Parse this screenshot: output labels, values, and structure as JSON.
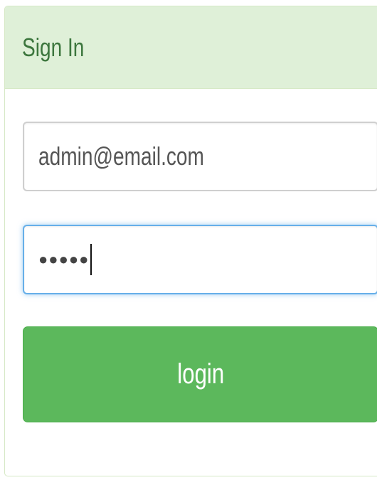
{
  "panel": {
    "title": "Sign In"
  },
  "form": {
    "email_value": "admin@email.com",
    "password_value": "●●●●●",
    "login_label": "login"
  },
  "colors": {
    "heading_bg": "#dff0d8",
    "heading_text": "#3c763d",
    "focus_border": "#66afe9",
    "button_bg": "#5cb85c"
  }
}
